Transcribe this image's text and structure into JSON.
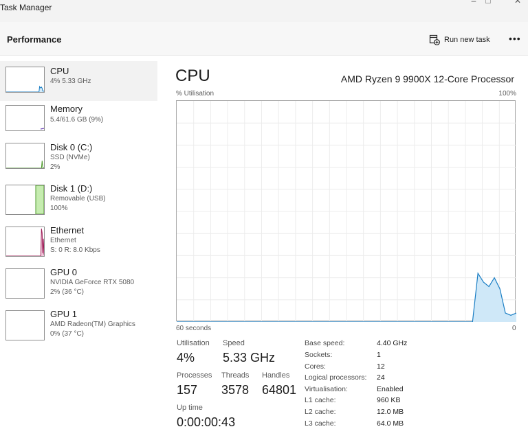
{
  "window": {
    "title": "Task Manager"
  },
  "header": {
    "title": "Performance",
    "run_task_label": "Run new task",
    "more_label": "•••"
  },
  "sidebar": {
    "items": [
      {
        "name": "CPU",
        "line1": "4% 5.33 GHz",
        "line2": ""
      },
      {
        "name": "Memory",
        "line1": "5.4/61.6 GB (9%)",
        "line2": ""
      },
      {
        "name": "Disk 0 (C:)",
        "line1": "SSD (NVMe)",
        "line2": "2%"
      },
      {
        "name": "Disk 1 (D:)",
        "line1": "Removable (USB)",
        "line2": "100%"
      },
      {
        "name": "Ethernet",
        "line1": "Ethernet",
        "line2": "S: 0 R: 8.0 Kbps"
      },
      {
        "name": "GPU 0",
        "line1": "NVIDIA GeForce RTX 5080",
        "line2": "2% (36 °C)"
      },
      {
        "name": "GPU 1",
        "line1": "AMD Radeon(TM) Graphics",
        "line2": "0% (37 °C)"
      }
    ]
  },
  "main": {
    "title": "CPU",
    "processor": "AMD Ryzen 9 9900X 12-Core Processor",
    "graph_label": "% Utilisation",
    "graph_max": "100%",
    "axis_left": "60 seconds",
    "axis_right": "0",
    "stats": {
      "utilisation_label": "Utilisation",
      "utilisation_value": "4%",
      "speed_label": "Speed",
      "speed_value": "5.33 GHz",
      "processes_label": "Processes",
      "processes_value": "157",
      "threads_label": "Threads",
      "threads_value": "3578",
      "handles_label": "Handles",
      "handles_value": "64801",
      "uptime_label": "Up time",
      "uptime_value": "0:00:00:43"
    },
    "specs": [
      {
        "label": "Base speed:",
        "value": "4.40 GHz"
      },
      {
        "label": "Sockets:",
        "value": "1"
      },
      {
        "label": "Cores:",
        "value": "12"
      },
      {
        "label": "Logical processors:",
        "value": "24"
      },
      {
        "label": "Virtualisation:",
        "value": "Enabled"
      },
      {
        "label": "L1 cache:",
        "value": "960 KB"
      },
      {
        "label": "L2 cache:",
        "value": "12.0 MB"
      },
      {
        "label": "L3 cache:",
        "value": "64.0 MB"
      }
    ]
  },
  "chart_data": {
    "type": "area",
    "ylim": [
      0,
      100
    ],
    "x": [
      60,
      59,
      58,
      57,
      56,
      55,
      54,
      53,
      52,
      51,
      50,
      49,
      48,
      47,
      46,
      45,
      44,
      43,
      42,
      41,
      40,
      39,
      38,
      37,
      36,
      35,
      34,
      33,
      32,
      31,
      30,
      29,
      28,
      27,
      26,
      25,
      24,
      23,
      22,
      21,
      20,
      19,
      18,
      17,
      16,
      15,
      14,
      13,
      12,
      11,
      10,
      9,
      8,
      7,
      6,
      5,
      4,
      3,
      2,
      1,
      0
    ],
    "values": [
      0,
      0,
      0,
      0,
      0,
      0,
      0,
      0,
      0,
      0,
      0,
      0,
      0,
      0,
      0,
      0,
      0,
      0,
      0,
      0,
      0,
      0,
      0,
      0,
      0,
      0,
      0,
      0,
      0,
      0,
      0,
      0,
      0,
      0,
      0,
      0,
      0,
      0,
      0,
      0,
      0,
      0,
      0,
      0,
      0,
      0,
      0,
      0,
      0,
      0,
      0,
      0,
      0,
      0,
      0,
      22,
      18,
      16,
      20,
      15,
      4,
      3,
      4
    ],
    "color_line": "#1a7ec4",
    "color_fill": "#cfe8f8"
  },
  "sidebar_thumbs": {
    "cpu_color": "#1a7ec4",
    "memory_color": "#6a3fb5",
    "disk0_color": "#4c9a2a",
    "disk1_color": "#4c9a2a",
    "disk1_fill": "#c6ecb0",
    "ethernet_color": "#a0205a",
    "disk1_level_pct": 100,
    "cpu_series": [
      0,
      0,
      0,
      0,
      0,
      0,
      0,
      0,
      0,
      0,
      0,
      0,
      0,
      0,
      0,
      0,
      0,
      0,
      0,
      0,
      0,
      0,
      0,
      0,
      0,
      0,
      0,
      0,
      0,
      0,
      0,
      0,
      0,
      0,
      0,
      0,
      0,
      0,
      0,
      0,
      0,
      0,
      0,
      0,
      0,
      0,
      0,
      0,
      0,
      0,
      0,
      0,
      0,
      22,
      18,
      16,
      20,
      15,
      4,
      3,
      4
    ],
    "disk0_series": [
      0,
      0,
      0,
      0,
      0,
      0,
      0,
      0,
      0,
      0,
      0,
      0,
      0,
      0,
      0,
      0,
      0,
      0,
      0,
      0,
      0,
      0,
      0,
      0,
      0,
      0,
      0,
      0,
      0,
      0,
      0,
      0,
      0,
      0,
      0,
      0,
      0,
      0,
      0,
      0,
      0,
      0,
      0,
      0,
      0,
      0,
      0,
      0,
      0,
      0,
      0,
      0,
      0,
      0,
      0,
      0,
      0,
      30,
      2,
      1,
      2
    ],
    "ethernet_series": [
      0,
      0,
      0,
      0,
      0,
      0,
      0,
      0,
      0,
      0,
      0,
      0,
      0,
      0,
      0,
      0,
      0,
      0,
      0,
      0,
      0,
      0,
      0,
      0,
      0,
      0,
      0,
      0,
      0,
      0,
      0,
      0,
      0,
      0,
      0,
      0,
      0,
      0,
      0,
      0,
      0,
      0,
      0,
      0,
      0,
      0,
      0,
      0,
      0,
      0,
      0,
      0,
      0,
      0,
      0,
      0,
      95,
      80,
      10,
      60,
      5
    ]
  }
}
